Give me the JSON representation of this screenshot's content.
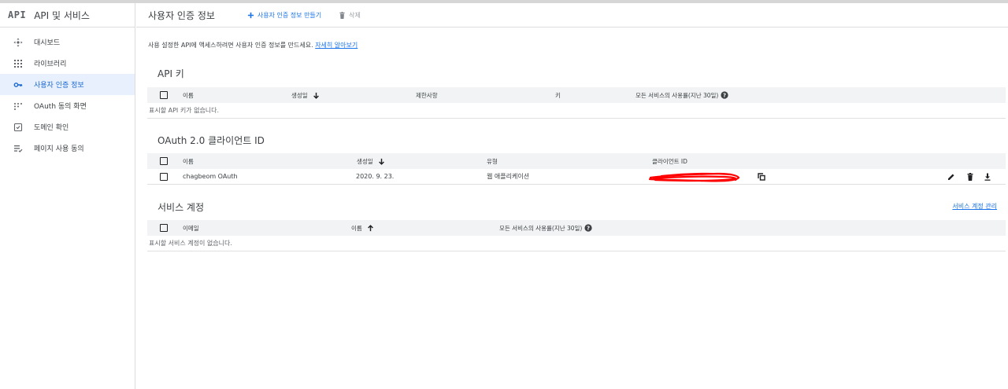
{
  "app": {
    "logo_text": "API",
    "title": "API 및 서비스"
  },
  "sidebar": {
    "items": [
      {
        "label": "대시보드",
        "icon": "dashboard-icon"
      },
      {
        "label": "라이브러리",
        "icon": "library-icon"
      },
      {
        "label": "사용자 인증 정보",
        "icon": "key-icon",
        "active": true
      },
      {
        "label": "OAuth 동의 화면",
        "icon": "oauth-consent-icon"
      },
      {
        "label": "도메인 확인",
        "icon": "domain-verification-icon"
      },
      {
        "label": "페이지 사용 동의",
        "icon": "page-usage-icon"
      }
    ]
  },
  "header": {
    "title": "사용자 인증 정보",
    "create_label": "사용자 인증 정보 만들기",
    "delete_label": "삭제"
  },
  "intro": {
    "text": "사용 설정한 API에 액세스하려면 사용자 인증 정보를 만드세요.",
    "link": "자세히 알아보기"
  },
  "api_keys": {
    "title": "API 키",
    "columns": [
      "이름",
      "생성일",
      "제한사항",
      "키",
      "모든 서비스의 사용률(지난 30일)"
    ],
    "empty": "표시할 API 키가 없습니다."
  },
  "oauth": {
    "title": "OAuth 2.0 클라이언트 ID",
    "columns": [
      "이름",
      "생성일",
      "유형",
      "클라이언트 ID"
    ],
    "rows": [
      {
        "name": "chagbeom OAuth",
        "created": "2020. 9. 23.",
        "type": "웹 애플리케이션",
        "client_id": ""
      }
    ]
  },
  "service_accounts": {
    "title": "서비스 계정",
    "manage_label": "서비스 계정 관리",
    "columns": [
      "이메일",
      "이름",
      "모든 서비스의 사용률(지난 30일)"
    ],
    "empty": "표시할 서비스 계정이 없습니다."
  },
  "colors": {
    "accent": "#1a73e8",
    "active_bg": "#e8f0fe",
    "header_bg": "#f1f3f4",
    "redaction": "#ff0000"
  }
}
